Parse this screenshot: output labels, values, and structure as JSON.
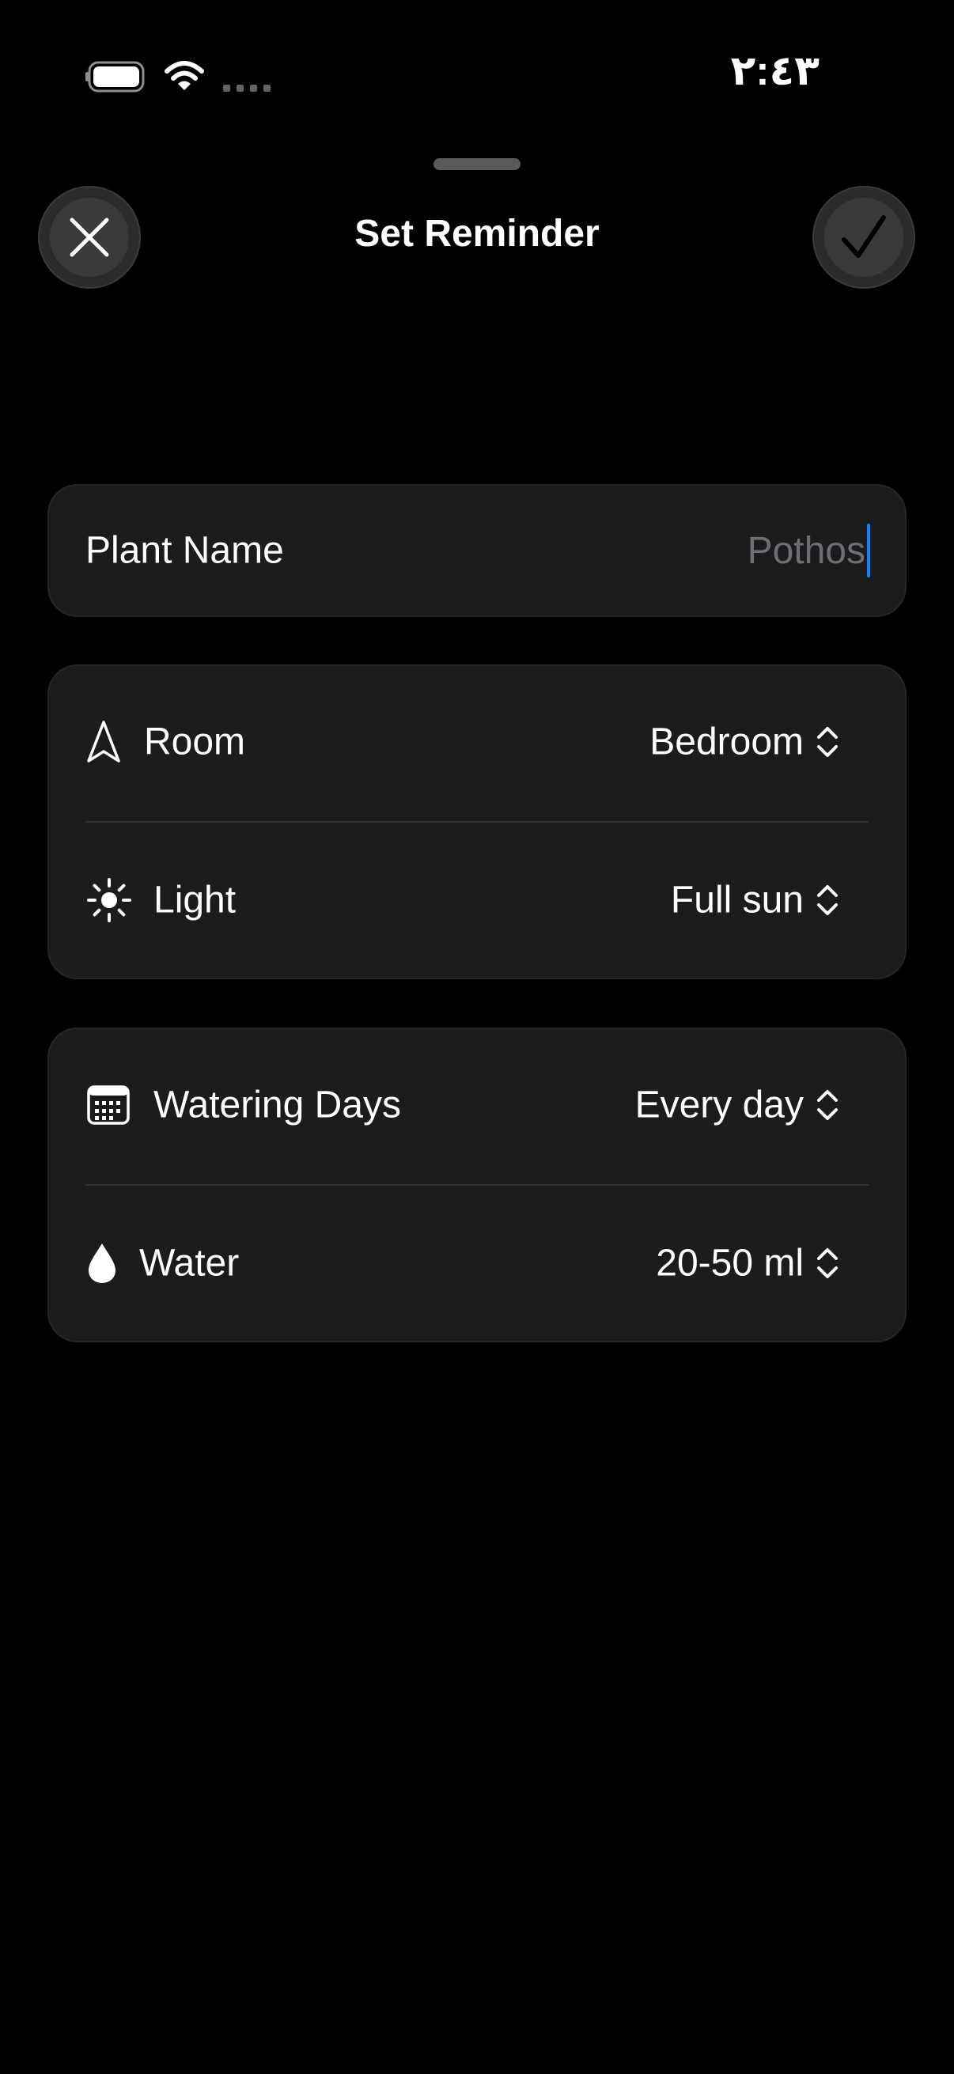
{
  "status_bar": {
    "time": "٢:٤٣",
    "icons": [
      "battery-icon",
      "wifi-icon",
      "cellular-signal-icon"
    ]
  },
  "header": {
    "title": "Set Reminder",
    "close_icon": "close-icon",
    "confirm_icon": "checkmark-icon"
  },
  "plant_name": {
    "label": "Plant Name",
    "value": "",
    "placeholder": "Pothos"
  },
  "location": {
    "room": {
      "label": "Room",
      "value": "Bedroom",
      "icon": "location-arrow-icon"
    },
    "light": {
      "label": "Light",
      "value": "Full sun",
      "icon": "sun-icon"
    }
  },
  "watering": {
    "days": {
      "label": "Watering Days",
      "value": "Every day",
      "icon": "calendar-icon"
    },
    "water": {
      "label": "Water",
      "value": "20-50 ml",
      "icon": "water-drop-icon"
    }
  },
  "colors": {
    "background": "#000000",
    "card": "#1c1c1e",
    "accent_caret": "#0a84ff",
    "placeholder": "#6e6e73"
  }
}
